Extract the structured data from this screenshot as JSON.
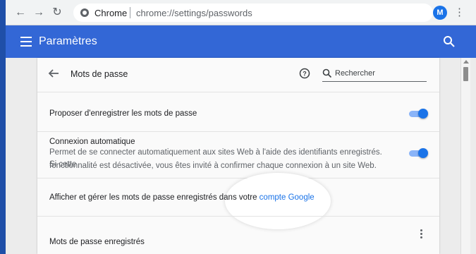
{
  "browser": {
    "back": "←",
    "forward": "→",
    "reload": "↻",
    "site_chip": "Chrome",
    "url": "chrome://settings/passwords",
    "star": "☆",
    "avatar_letter": "M",
    "menu": "⋮"
  },
  "header": {
    "title": "Paramètres",
    "accent_color": "#3367d6"
  },
  "passwords_page": {
    "title": "Mots de passe",
    "search_placeholder": "Rechercher",
    "offer_to_save_label": "Proposer d'enregistrer les mots de passe",
    "offer_to_save_enabled": true,
    "auto_signin_label": "Connexion automatique",
    "auto_signin_desc_line1": "Permet de se connecter automatiquement aux sites Web à l'aide des identifiants enregistrés. Si cette",
    "auto_signin_desc_line2": "fonctionnalité est désactivée, vous êtes invité à confirmer chaque connexion à un site Web.",
    "auto_signin_enabled": true,
    "manage_text": "Afficher et gérer les mots de passe enregistrés dans votre ",
    "manage_link": "compte Google",
    "saved_passwords_heading": "Mots de passe enregistrés"
  }
}
